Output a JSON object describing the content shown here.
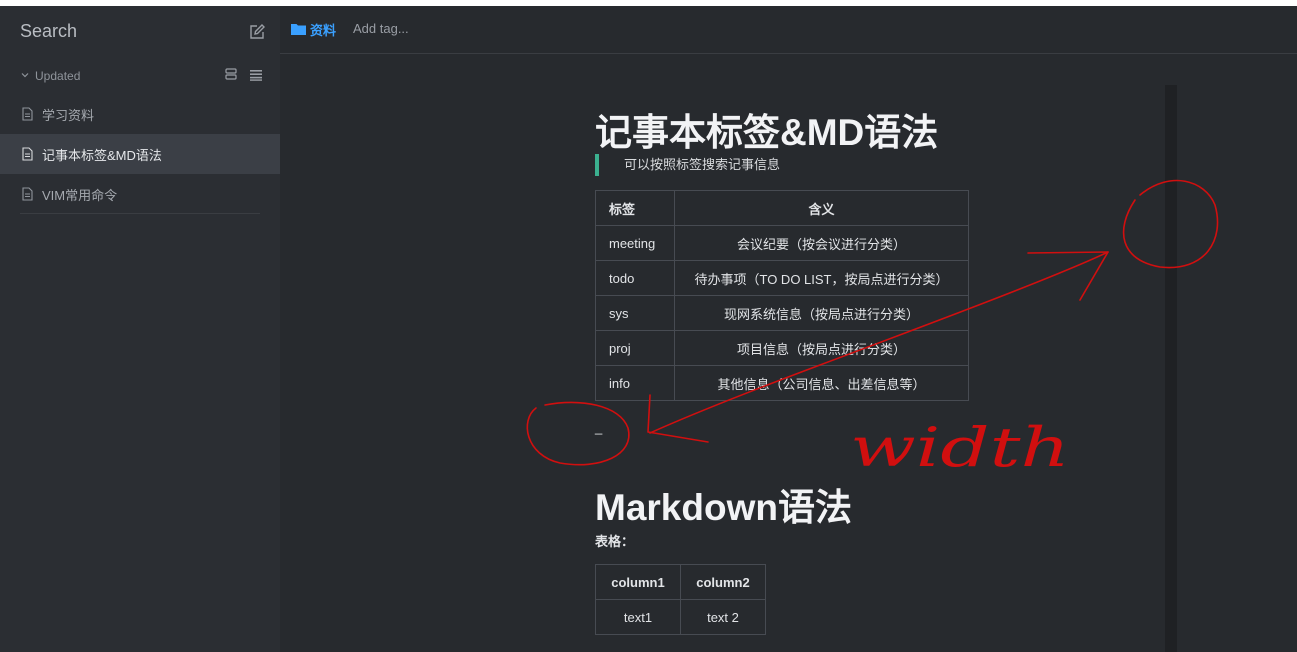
{
  "sidebar": {
    "search_label": "Search",
    "sort_label": "Updated",
    "notes": [
      {
        "title": "学习资料"
      },
      {
        "title": "记事本标签&MD语法"
      },
      {
        "title": "VIM常用命令"
      }
    ]
  },
  "header": {
    "folder_name": "资料",
    "add_tag_placeholder": "Add tag..."
  },
  "document": {
    "title": "记事本标签&MD语法",
    "quote": "可以按照标签搜索记事信息",
    "tags_table": {
      "headers": [
        "标签",
        "含义"
      ],
      "rows": [
        [
          "meeting",
          "会议纪要（按会议进行分类）"
        ],
        [
          "todo",
          "待办事项（TO DO LIST，按局点进行分类）"
        ],
        [
          "sys",
          "现网系统信息（按局点进行分类）"
        ],
        [
          "proj",
          "项目信息（按局点进行分类）"
        ],
        [
          "info",
          "其他信息（公司信息、出差信息等）"
        ]
      ]
    },
    "cursor_text": "_",
    "h2": "Markdown语法",
    "paragraph": "表格：",
    "md_table": {
      "headers": [
        "column1",
        "column2"
      ],
      "rows": [
        [
          "text1",
          "text 2"
        ]
      ]
    }
  },
  "annotation": {
    "handwritten_text": "width",
    "color": "#d10f0f"
  },
  "colors": {
    "background": "#272a2e",
    "sidebar": "#2b2e33",
    "active_item": "#3b3f46",
    "accent": "#3aa0ff",
    "quote_bar": "#3bb08f"
  }
}
